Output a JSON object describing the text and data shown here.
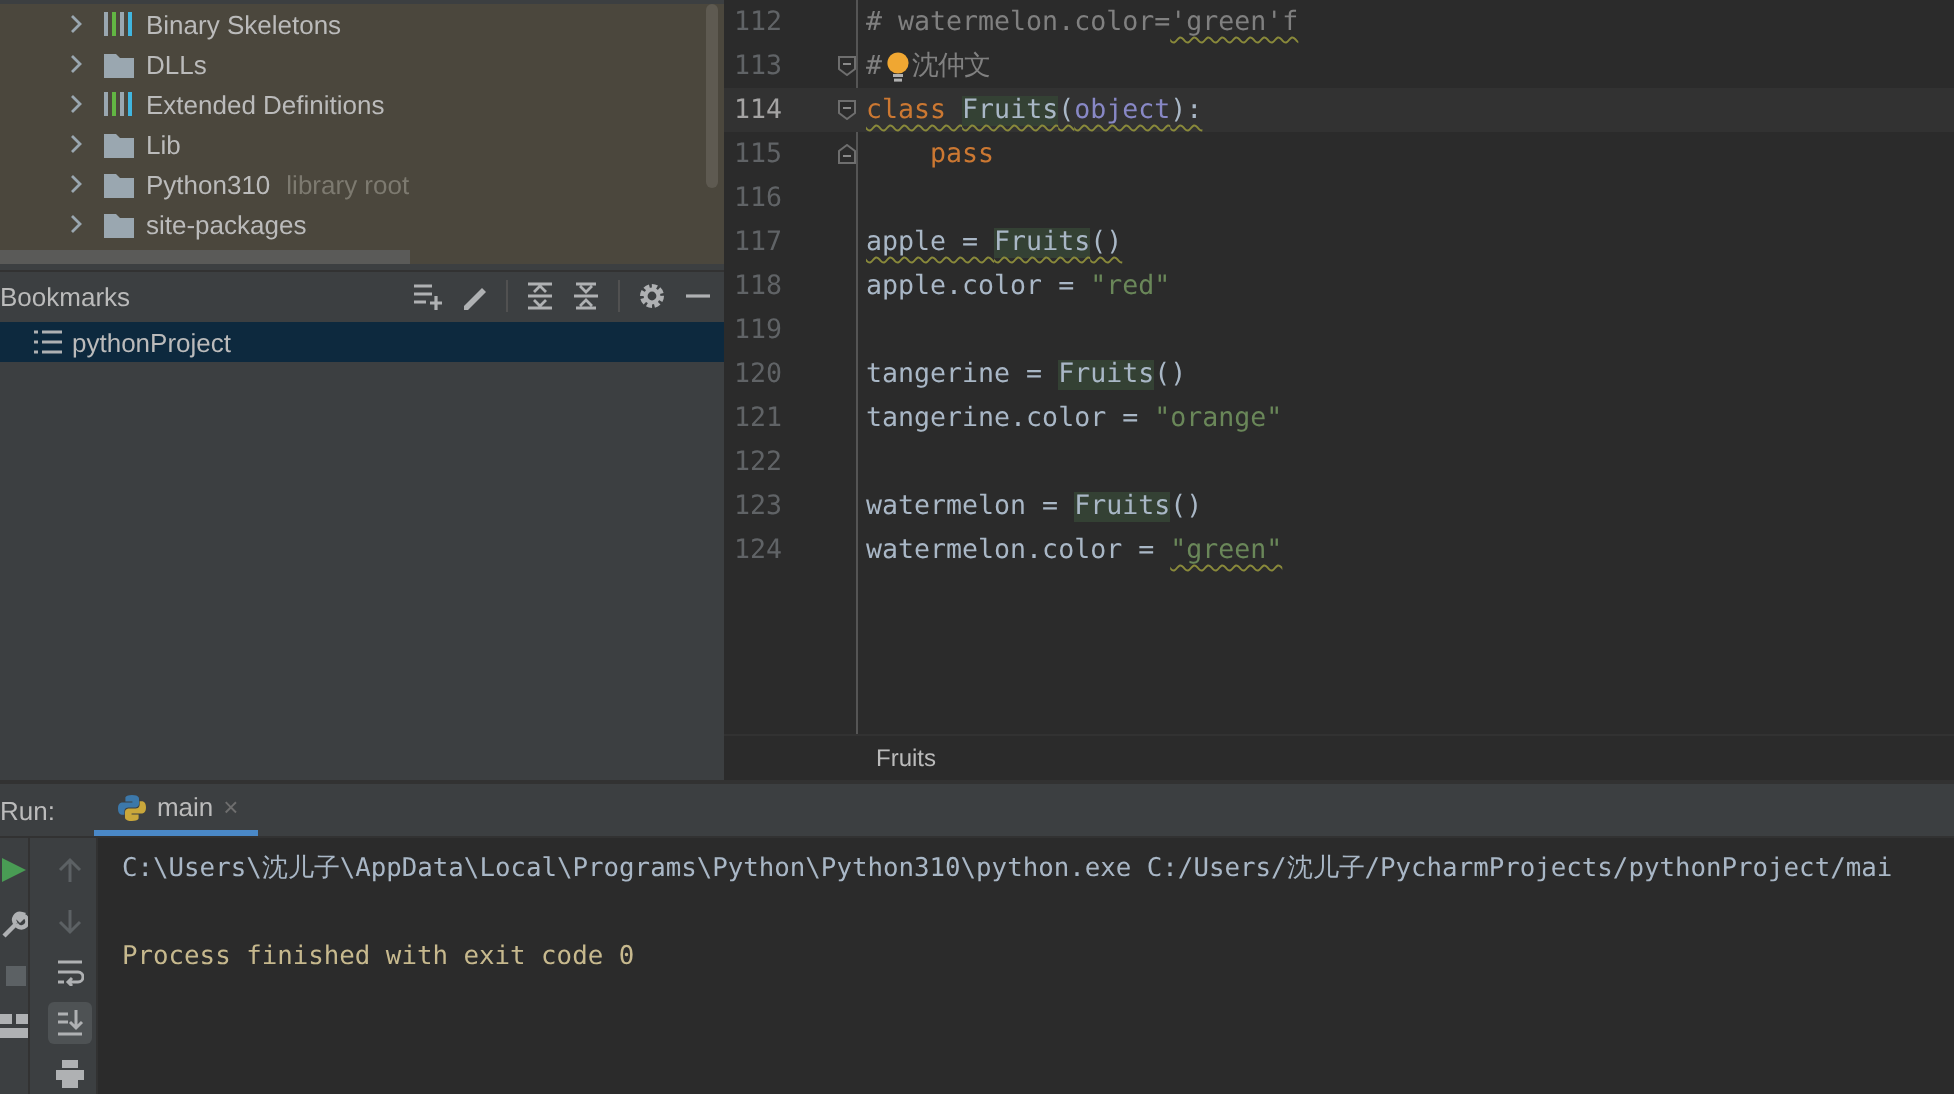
{
  "project_tree": {
    "items": [
      {
        "label": "Binary Skeletons",
        "kind": "library",
        "expanded": false
      },
      {
        "label": "DLLs",
        "kind": "folder",
        "expanded": false
      },
      {
        "label": "Extended Definitions",
        "kind": "library",
        "expanded": false
      },
      {
        "label": "Lib",
        "kind": "folder",
        "expanded": false
      },
      {
        "label": "Python310",
        "kind": "folder",
        "expanded": false,
        "note": "library root"
      },
      {
        "label": "site-packages",
        "kind": "folder",
        "expanded": false
      }
    ]
  },
  "bookmarks": {
    "title": "Bookmarks",
    "items": [
      {
        "label": "pythonProject",
        "selected": true
      }
    ]
  },
  "editor": {
    "lines": [
      {
        "number": "112",
        "current": false,
        "kind": "plain",
        "tokens": [
          {
            "text": "# watermelon.color=",
            "kind": "comment",
            "warning": false
          },
          {
            "text": "'green'f",
            "kind": "comment",
            "warning": true
          }
        ]
      },
      {
        "number": "113",
        "current": false,
        "kind": "opener",
        "tokens": [
          {
            "text": "#",
            "kind": "comment",
            "warning": false
          },
          {
            "kind": "bulb",
            "warning": false
          },
          {
            "text": "沈仲文",
            "kind": "comment",
            "warning": false
          }
        ]
      },
      {
        "number": "114",
        "current": true,
        "kind": "opener",
        "tokens": [
          {
            "text": "class ",
            "kind": "keyword",
            "warning": true
          },
          {
            "text": "Fruits",
            "kind": "occurrence",
            "warning": true
          },
          {
            "text": "(",
            "kind": "plain",
            "warning": true
          },
          {
            "text": "object",
            "kind": "builtin",
            "warning": true
          },
          {
            "text": "):",
            "kind": "plain",
            "warning": true
          }
        ]
      },
      {
        "number": "115",
        "current": false,
        "kind": "closer",
        "tokens": [
          {
            "kind": "indent",
            "warning": false
          },
          {
            "text": "pass",
            "kind": "keyword",
            "warning": false
          }
        ]
      },
      {
        "number": "116",
        "current": false,
        "kind": "plain"
      },
      {
        "number": "117",
        "current": false,
        "kind": "plain",
        "tokens": [
          {
            "text": "apple = ",
            "kind": "plain",
            "warning": true
          },
          {
            "text": "Fruits",
            "kind": "occurrence",
            "warning": true
          },
          {
            "text": "()",
            "kind": "plain",
            "warning": true
          }
        ]
      },
      {
        "number": "118",
        "current": false,
        "kind": "plain",
        "tokens": [
          {
            "text": "apple.color = ",
            "kind": "plain",
            "warning": false
          },
          {
            "text": "\"red\"",
            "kind": "string",
            "warning": false
          }
        ]
      },
      {
        "number": "119",
        "current": false,
        "kind": "plain"
      },
      {
        "number": "120",
        "current": false,
        "kind": "plain",
        "tokens": [
          {
            "text": "tangerine = ",
            "kind": "plain",
            "warning": false
          },
          {
            "text": "Fruits",
            "kind": "occurrence",
            "warning": false
          },
          {
            "text": "()",
            "kind": "plain",
            "warning": false
          }
        ]
      },
      {
        "number": "121",
        "current": false,
        "kind": "plain",
        "tokens": [
          {
            "text": "tangerine.color = ",
            "kind": "plain",
            "warning": false
          },
          {
            "text": "\"orange\"",
            "kind": "string",
            "warning": false
          }
        ]
      },
      {
        "number": "122",
        "current": false,
        "kind": "plain"
      },
      {
        "number": "123",
        "current": false,
        "kind": "plain",
        "tokens": [
          {
            "text": "watermelon = ",
            "kind": "plain",
            "warning": false
          },
          {
            "text": "Fruits",
            "kind": "occurrence",
            "warning": false
          },
          {
            "text": "()",
            "kind": "plain",
            "warning": false
          }
        ]
      },
      {
        "number": "124",
        "current": false,
        "kind": "plain",
        "tokens": [
          {
            "text": "watermelon.color = ",
            "kind": "plain",
            "warning": false
          },
          {
            "text": "\"green\"",
            "kind": "string",
            "warning": true
          }
        ]
      }
    ],
    "breadcrumb": "Fruits"
  },
  "run": {
    "label": "Run:",
    "tabs": [
      {
        "label": "main",
        "selected": true,
        "close": "×"
      }
    ],
    "actions": [
      {
        "kind": "rerun",
        "disabled": false
      },
      {
        "kind": "settings",
        "disabled": false
      },
      {
        "kind": "stop",
        "disabled": true
      },
      {
        "kind": "layout",
        "disabled": false
      }
    ],
    "console_tools": [
      {
        "kind": "up",
        "disabled": true,
        "selected": false
      },
      {
        "kind": "down",
        "disabled": true,
        "selected": false
      },
      {
        "kind": "wrap",
        "disabled": false,
        "selected": false
      },
      {
        "kind": "scroll-end",
        "disabled": false,
        "selected": true
      },
      {
        "kind": "print",
        "disabled": false,
        "selected": false
      }
    ],
    "console": [
      {
        "text": "C:\\Users\\沈儿子\\AppData\\Local\\Programs\\Python\\Python310\\python.exe C:/Users/沈儿子/PycharmProjects/pythonProject/mai",
        "kind": "command"
      },
      {
        "text": "Process finished with exit code 0",
        "kind": "exit"
      }
    ]
  }
}
